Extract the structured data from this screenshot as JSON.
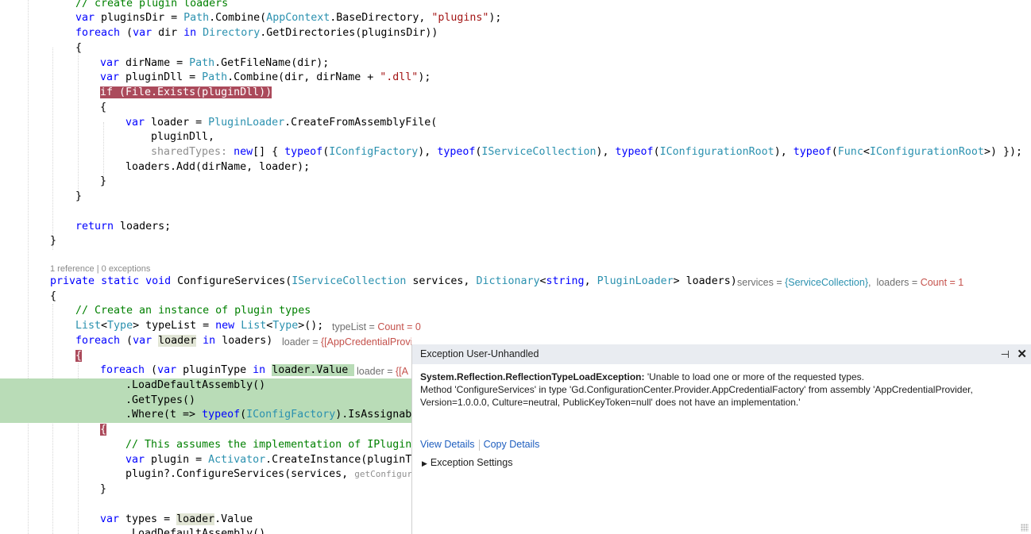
{
  "editor": {
    "lines": {
      "l00": {
        "comment": "// create plugin loaders"
      },
      "l01": {
        "kw": "var",
        "name": " pluginsDir = ",
        "type1": "Path",
        "mid": ".Combine(",
        "type2": "AppContext",
        "mid2": ".BaseDirectory, ",
        "str": "\"plugins\"",
        "end": ");"
      },
      "l02": {
        "kw": "foreach",
        "a": " (",
        "kw2": "var",
        "b": " dir ",
        "kw3": "in",
        "c": " ",
        "type": "Directory",
        "d": ".GetDirectories(pluginsDir))"
      },
      "l03": {
        "text": "{"
      },
      "l04": {
        "kw": "var",
        "a": " dirName = ",
        "type": "Path",
        "b": ".GetFileName(dir);"
      },
      "l05": {
        "kw": "var",
        "a": " pluginDll = ",
        "type": "Path",
        "b": ".Combine(dir, dirName + ",
        "str": "\".dll\"",
        "c": ");"
      },
      "l06": {
        "text": "if (File.Exists(pluginDll))"
      },
      "l07": {
        "text": "{"
      },
      "l08": {
        "kw": "var",
        "a": " loader = ",
        "type": "PluginLoader",
        "b": ".CreateFromAssemblyFile("
      },
      "l09": {
        "text": "pluginDll,"
      },
      "l10": {
        "param": "sharedTypes:",
        "sp": " ",
        "kw": "new",
        "a": "[] { ",
        "k1": "typeof",
        "p1": "(",
        "t1": "IConfigFactory",
        "e1": "), ",
        "k2": "typeof",
        "p2": "(",
        "t2": "IServiceCollection",
        "e2": "), ",
        "k3": "typeof",
        "p3": "(",
        "t3": "IConfigurationRoot",
        "e3": "), ",
        "k4": "typeof",
        "p4": "(",
        "t4a": "Func",
        "lt": "<",
        "t4b": "IConfigurationRoot",
        "e4": ">) });"
      },
      "l11": {
        "text": "loaders.Add(dirName, loader);"
      },
      "l12": {
        "text": "}"
      },
      "l13": {
        "text": "}"
      },
      "l15": {
        "kw": "return",
        "a": " loaders;"
      },
      "l16": {
        "text": "}"
      },
      "l18": {
        "k1": "private",
        "s1": " ",
        "k2": "static",
        "s2": " ",
        "k3": "void",
        "a": " ConfigureServices(",
        "t1": "IServiceCollection",
        "b": " services, ",
        "t2": "Dictionary",
        "lt": "<",
        "k4": "string",
        "c": ", ",
        "t3": "PluginLoader",
        "d": "> loaders)"
      },
      "l19": {
        "text": "{"
      },
      "l20": {
        "comment": "// Create an instance of plugin types"
      },
      "l21": {
        "t1": "List",
        "lt": "<",
        "t2": "Type",
        "a": "> typeList = ",
        "kw": "new",
        "s": " ",
        "t3": "List",
        "lt2": "<",
        "t4": "Type",
        "b": ">();"
      },
      "l22": {
        "kw": "foreach",
        "a": " (",
        "kw2": "var",
        "s": " ",
        "rh": "loader",
        "s2": " ",
        "kw3": "in",
        "b": " loaders)"
      },
      "l23": {
        "text": "{"
      },
      "l24": {
        "kw": "foreach",
        "a": " (",
        "kw2": "var",
        "b": " pluginType ",
        "kw3": "in",
        "s": " ",
        "g": "loader.Value "
      },
      "l25": {
        "text": ".LoadDefaultAssembly()"
      },
      "l26": {
        "text": ".GetTypes()"
      },
      "l27": {
        "a": ".Where(t => ",
        "kw": "typeof",
        "p": "(",
        "type": "IConfigFactory",
        "b": ").IsAssignabl"
      },
      "l28": {
        "text": "{"
      },
      "l29": {
        "comment": "// This assumes the implementation of IPluginF"
      },
      "l30": {
        "kw": "var",
        "a": " plugin = ",
        "type": "Activator",
        "b": ".CreateInstance(pluginTy"
      },
      "l31": {
        "a": "plugin?.ConfigureServices(services, ",
        "ph": "getConfigura"
      },
      "l32": {
        "text": "}"
      },
      "l34": {
        "kw": "var",
        "a": " types = ",
        "rh": "loader",
        "b": ".Value"
      },
      "l35": {
        "text": ".LoadDefaultAssembly()"
      }
    },
    "codelens": {
      "references": "1 reference",
      "sep": " | ",
      "exceptions": "0 exceptions"
    },
    "datatips": {
      "services": {
        "name": "services = ",
        "value": "{ServiceCollection}",
        "sep": ",  "
      },
      "loaders": {
        "name": "loaders = ",
        "value": "Count = 1"
      },
      "typeList": {
        "name": "typeList = ",
        "value": "Count = 0"
      },
      "loader": {
        "name": "loader = ",
        "value": "{[AppCredentialProvider, McMaster.NETCore.Plugins.PluginLoader]}"
      },
      "loaderInner": {
        "name": "loader = ",
        "value": "{[A"
      }
    }
  },
  "exception": {
    "title": "Exception User-Unhandled",
    "type": "System.Reflection.ReflectionTypeLoadException:",
    "message": " 'Unable to load one or more of the requested types.",
    "detail": "Method 'ConfigureServices' in type 'Gd.ConfigurationCenter.Provider.AppCredentialFactory' from assembly 'AppCredentialProvider, Version=1.0.0.0, Culture=neutral, PublicKeyToken=null' does not have an implementation.'",
    "view_details": "View Details",
    "copy_details": "Copy Details",
    "settings": "Exception Settings",
    "pin_icon": "pin-icon",
    "close_icon": "close-icon"
  }
}
